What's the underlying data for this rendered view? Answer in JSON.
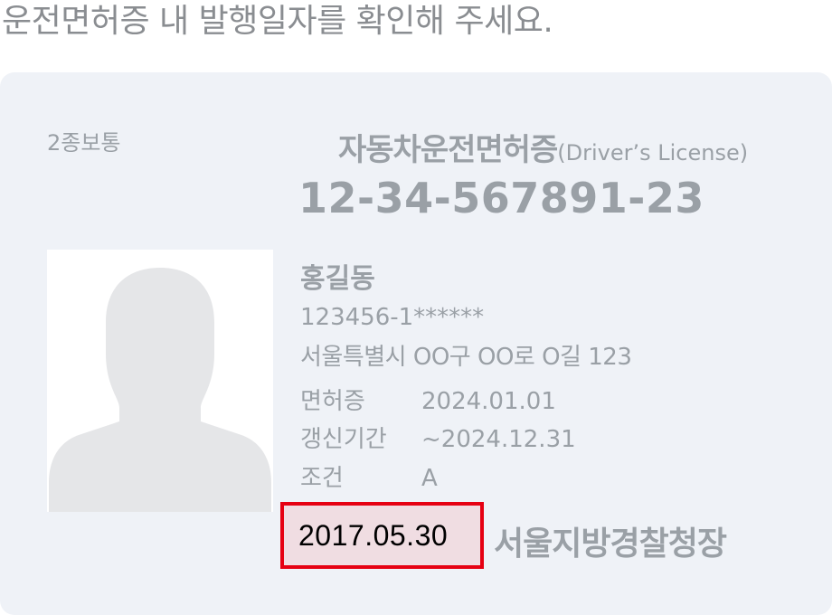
{
  "instruction": "운전면허증 내 발행일자를 확인해 주세요.",
  "license": {
    "type": "2종보통",
    "title": "자동차운전면허증",
    "title_sub": "(Driver’s License)",
    "number": "12-34-567891-23",
    "photo_icon": "person-silhouette-icon",
    "name": "홍길동",
    "resident_number": "123456-1******",
    "address": "서울특별시 OO구 OO로 O길 123",
    "rows": [
      {
        "label": "면허증",
        "value": "2024.01.01"
      },
      {
        "label": "갱신기간",
        "value": "~2024.12.31"
      },
      {
        "label": "조건",
        "value": "A"
      }
    ],
    "issue_date": "2017.05.30",
    "issuer": "서울지방경찰청장"
  },
  "colors": {
    "card_background": "#eff2f7",
    "muted_text": "#9aa0a6",
    "highlight_border": "#e60012",
    "highlight_fill": "#f0dde2"
  }
}
